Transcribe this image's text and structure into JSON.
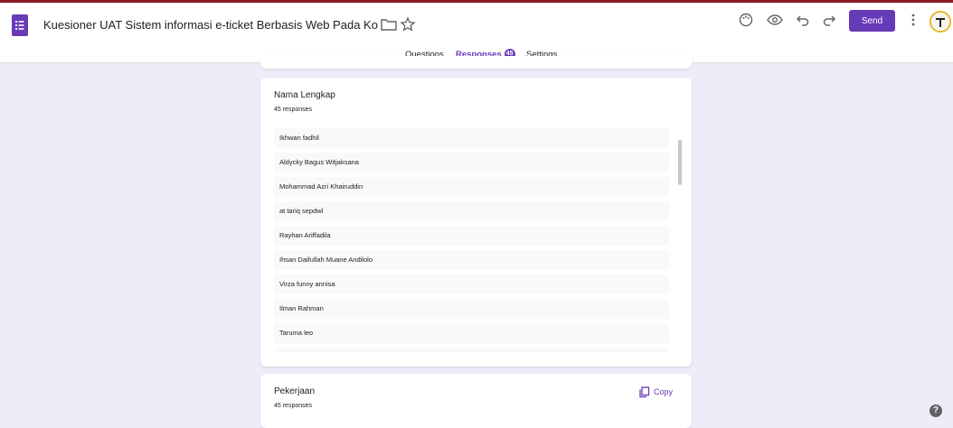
{
  "header": {
    "title": "Kuesioner UAT Sistem informasi e-ticket Berbasis Web Pada Kolam Renang",
    "send_label": "Send",
    "icons": [
      "palette-icon",
      "preview-eye-icon",
      "undo-icon",
      "redo-icon",
      "more-vert-icon"
    ]
  },
  "tabs": [
    {
      "label": "Questions"
    },
    {
      "label": "Responses",
      "badge": "45"
    },
    {
      "label": "Settings"
    }
  ],
  "question1": {
    "title": "Nama Lengkap",
    "count": "45 responses",
    "responses": [
      "Ikhwan fadhil",
      "Aldycky Bagus Witjaksana",
      "Mohammad Azri Khairuddin",
      "at tariq sepdwl",
      "Rayhan Ariffadila",
      "Ihsan Daifullah Muane Andilolo",
      "Virza funny annisa",
      "Ilman Rahman",
      "Taruma leo"
    ]
  },
  "question2": {
    "title": "Pekerjaan",
    "count": "45 responses",
    "copy_label": "Copy"
  },
  "help_label": "?",
  "colors": {
    "accent": "#673ab7",
    "background": "#efebf8",
    "row": "#f8f9fa"
  }
}
